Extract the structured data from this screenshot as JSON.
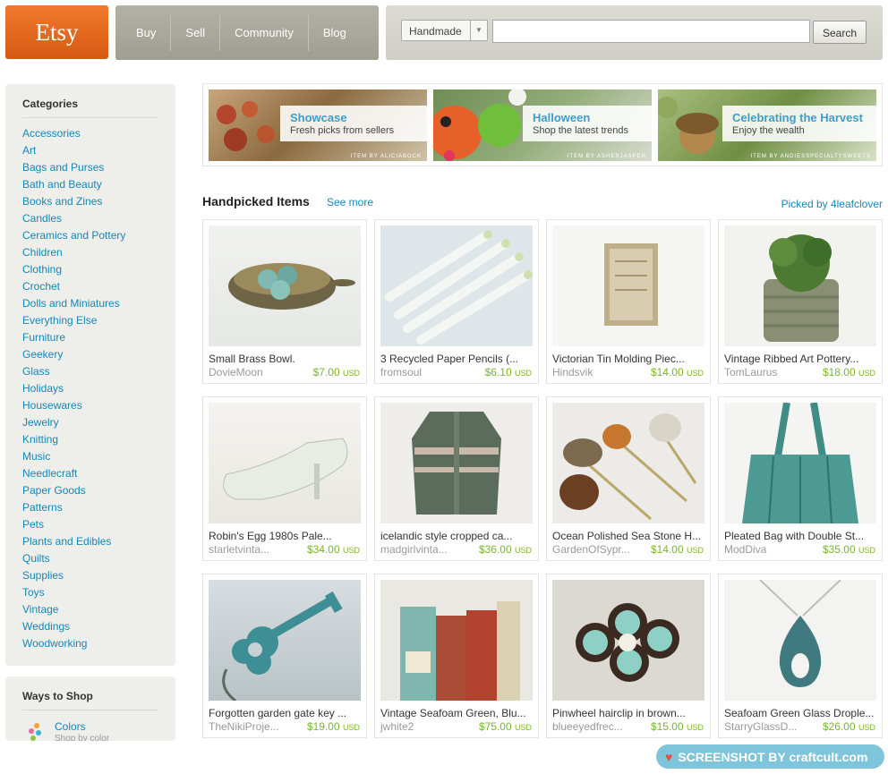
{
  "header": {
    "logo": "Etsy",
    "nav": [
      "Buy",
      "Sell",
      "Community",
      "Blog"
    ],
    "search": {
      "category": "Handmade",
      "value": "",
      "button": "Search"
    }
  },
  "sidebar": {
    "categories_title": "Categories",
    "categories": [
      "Accessories",
      "Art",
      "Bags and Purses",
      "Bath and Beauty",
      "Books and Zines",
      "Candles",
      "Ceramics and Pottery",
      "Children",
      "Clothing",
      "Crochet",
      "Dolls and Miniatures",
      "Everything Else",
      "Furniture",
      "Geekery",
      "Glass",
      "Holidays",
      "Housewares",
      "Jewelry",
      "Knitting",
      "Music",
      "Needlecraft",
      "Paper Goods",
      "Patterns",
      "Pets",
      "Plants and Edibles",
      "Quilts",
      "Supplies",
      "Toys",
      "Vintage",
      "Weddings",
      "Woodworking"
    ],
    "ways_title": "Ways to Shop",
    "ways": [
      {
        "label": "Colors",
        "sub": "Shop by color"
      }
    ]
  },
  "banners": [
    {
      "title": "Showcase",
      "subtitle": "Fresh picks from sellers",
      "credit": "ITEM BY ALICIABOCK"
    },
    {
      "title": "Halloween",
      "subtitle": "Shop the latest trends",
      "credit": "ITEM BY ASHERJASPER"
    },
    {
      "title": "Celebrating the Harvest",
      "subtitle": "Enjoy the wealth",
      "credit": "ITEM BY ANDIESSPECIALTYSWEETS"
    }
  ],
  "handpicked": {
    "title": "Handpicked Items",
    "see_more": "See more",
    "picked_by": "Picked by 4leafclover",
    "currency": "USD",
    "items": [
      {
        "title": "Small Brass Bowl.",
        "shop": "DovieMoon",
        "price": "$7.00"
      },
      {
        "title": "3 Recycled Paper Pencils (...",
        "shop": "fromsoul",
        "price": "$6.10"
      },
      {
        "title": "Victorian Tin Molding Piec...",
        "shop": "Hindsvik",
        "price": "$14.00"
      },
      {
        "title": "Vintage Ribbed Art Pottery...",
        "shop": "TomLaurus",
        "price": "$18.00"
      },
      {
        "title": "Robin's Egg 1980s Pale...",
        "shop": "starletvinta...",
        "price": "$34.00"
      },
      {
        "title": "icelandic style cropped ca...",
        "shop": "madgirlvinta...",
        "price": "$36.00"
      },
      {
        "title": "Ocean Polished Sea Stone H...",
        "shop": "GardenOfSypr...",
        "price": "$14.00"
      },
      {
        "title": "Pleated Bag with Double St...",
        "shop": "ModDiva",
        "price": "$35.00"
      },
      {
        "title": "Forgotten garden gate key ...",
        "shop": "TheNikiProje...",
        "price": "$19.00"
      },
      {
        "title": "Vintage Seafoam Green, Blu...",
        "shop": "jwhite2",
        "price": "$75.00"
      },
      {
        "title": "Pinwheel hairclip in brown...",
        "shop": "blueeyedfrec...",
        "price": "$15.00"
      },
      {
        "title": "Seafoam Green Glass Drople...",
        "shop": "StarryGlassD...",
        "price": "$26.00"
      }
    ]
  },
  "watermark": "SCREENSHOT BY craftcult.com"
}
